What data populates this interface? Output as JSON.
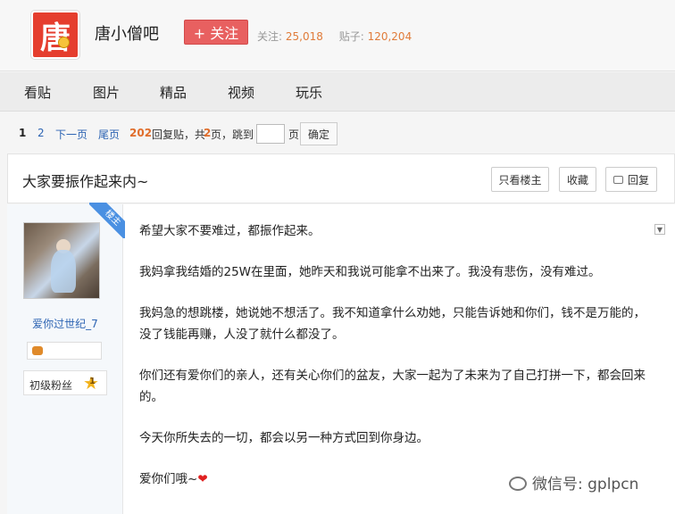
{
  "header": {
    "logo_char": "唐",
    "forum_name": "唐小僧吧",
    "follow_label": "+ 关注",
    "follow_count_label": "关注:",
    "follow_count": "25,018",
    "post_count_label": "贴子:",
    "post_count": "120,204"
  },
  "nav": {
    "items": [
      "看贴",
      "图片",
      "精品",
      "视频",
      "玩乐"
    ]
  },
  "pager": {
    "page1": "1",
    "page2": "2",
    "next": "下一页",
    "last": "尾页",
    "reply_count": "202",
    "reply_text": "回复贴，共",
    "total_pages": "2",
    "pages_text": "页，跳到",
    "page_unit": "页",
    "confirm": "确定"
  },
  "thread": {
    "title": "大家要振作起来内~",
    "only_op": "只看楼主",
    "favorite": "收藏",
    "reply": "回复"
  },
  "post": {
    "ribbon": "楼主",
    "author": "爱你过世纪_7",
    "level_title": "初级粉丝",
    "level": "1",
    "paragraphs": [
      "希望大家不要难过，都振作起来。",
      "我妈拿我结婚的25W在里面，她昨天和我说可能拿不出来了。我没有悲伤，没有难过。",
      "我妈急的想跳楼，她说她不想活了。我不知道拿什么劝她，只能告诉她和你们，钱不是万能的，没了钱能再赚，人没了就什么都没了。",
      "你们还有爱你们的亲人，还有关心你们的盆友，大家一起为了未来为了自己打拼一下，都会回来的。",
      "今天你所失去的一切，都会以另一种方式回到你身边。"
    ],
    "last_line": "爱你们哦~",
    "heart": "❤"
  },
  "watermark": "微信号: gplpcn"
}
